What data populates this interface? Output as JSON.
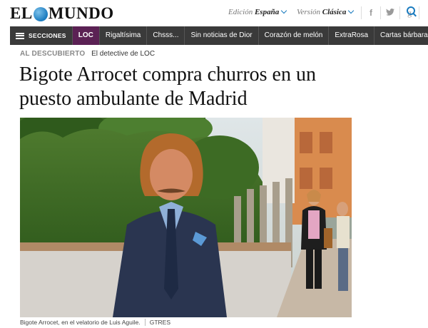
{
  "header": {
    "logo_left": "EL",
    "logo_right": "MUNDO",
    "edition_label": "Edición",
    "edition_value": "España",
    "version_label": "Versión",
    "version_value": "Clásica",
    "social_icons": [
      "facebook-icon",
      "twitter-icon",
      "google-plus-icon"
    ]
  },
  "nav": {
    "sections_label": "SECCIONES",
    "items": [
      "LOC",
      "Rigaltísima",
      "Chsss...",
      "Sin noticias de Dior",
      "Corazón de melón",
      "ExtraRosa",
      "Cartas bárbaras"
    ]
  },
  "article": {
    "kicker_section": "AL DESCUBIERTO",
    "kicker_sub": "El detective de LOC",
    "headline": "Bigote Arrocet compra churros en un puesto ambulante de Madrid",
    "caption": "Bigote Arrocet, en el velatorio de Luis Aguile.",
    "credit": "GTRES"
  },
  "colors": {
    "accent": "#1a7bbf",
    "nav_bg": "#3a3a3a",
    "loc_active": "#5b2154"
  }
}
